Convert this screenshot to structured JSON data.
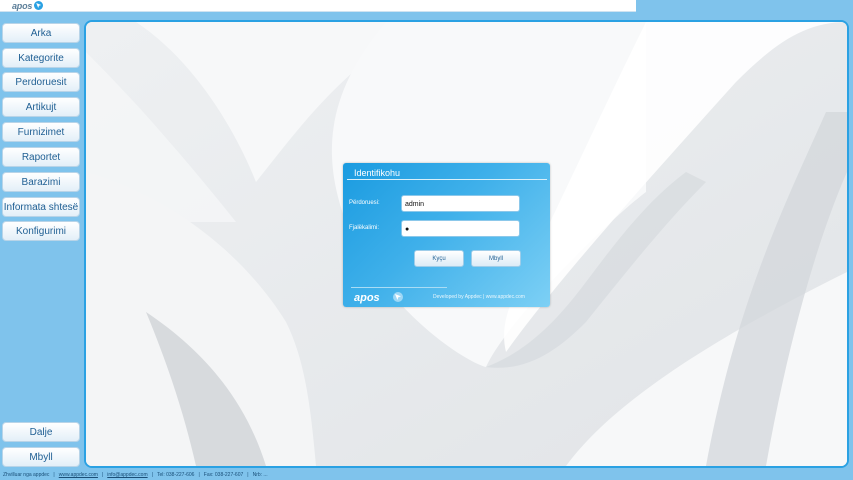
{
  "app": {
    "logo_text": "apos"
  },
  "sidebar": {
    "items": [
      {
        "label": "Arka"
      },
      {
        "label": "Kategorite"
      },
      {
        "label": "Perdoruesit"
      },
      {
        "label": "Artikujt"
      },
      {
        "label": "Furnizimet"
      },
      {
        "label": "Raportet"
      },
      {
        "label": "Barazimi"
      },
      {
        "label": "Informata shtesë"
      },
      {
        "label": "Konfigurimi"
      }
    ],
    "bottom": [
      {
        "label": "Dalje"
      },
      {
        "label": "Mbyll"
      }
    ]
  },
  "login": {
    "title": "Identifikohu",
    "username_label": "Përdoruesi:",
    "username_value": "admin",
    "password_label": "Fjalëkalimi:",
    "password_value": "●",
    "login_button": "Kyçu",
    "close_button": "Mbyll",
    "logo_text": "apos",
    "developer_text": "Developed by Appdec | www.appdec.com"
  },
  "footer": {
    "developed_by": "Zhvilluar nga appdec",
    "website": "www.appdec.com",
    "email": "info@appdec.com",
    "tel": "Tel: 038-227-606",
    "fax": "Fax: 038-227-607",
    "tax_id": "Nrb: ..."
  },
  "colors": {
    "accent": "#2aa1e3",
    "background": "#7fc3ec",
    "button_text": "#1f5f93"
  }
}
